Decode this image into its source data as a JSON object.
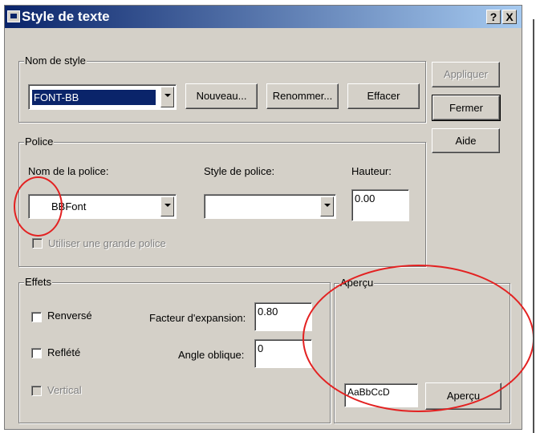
{
  "window": {
    "title": "Style de texte",
    "help_button": "?",
    "close_button": "X"
  },
  "style_group": {
    "legend": "Nom de style",
    "style_name": "FONT-BB",
    "new_button": "Nouveau...",
    "rename_button": "Renommer...",
    "delete_button": "Effacer"
  },
  "side_buttons": {
    "apply": "Appliquer",
    "close": "Fermer",
    "help": "Aide"
  },
  "font_group": {
    "legend": "Police",
    "font_name_label": "Nom de la police:",
    "font_name_value": "BBFont",
    "font_style_label": "Style de police:",
    "font_style_value": "",
    "height_label": "Hauteur:",
    "height_value": "0.00",
    "bigfont_label": "Utiliser une grande police"
  },
  "effects_group": {
    "legend": "Effets",
    "upside_down": "Renversé",
    "backwards": "Reflété",
    "vertical": "Vertical",
    "width_factor_label": "Facteur d'expansion:",
    "width_factor_value": "0.80",
    "oblique_label": "Angle oblique:",
    "oblique_value": "0"
  },
  "preview_group": {
    "legend": "Aperçu",
    "sample_text": "AaBbCcD",
    "preview_button": "Aperçu"
  },
  "colors": {
    "titlebar_start": "#0a246a",
    "titlebar_end": "#a6caf0",
    "dialog_face": "#d4d0c8",
    "annotation_red": "#e32121"
  }
}
